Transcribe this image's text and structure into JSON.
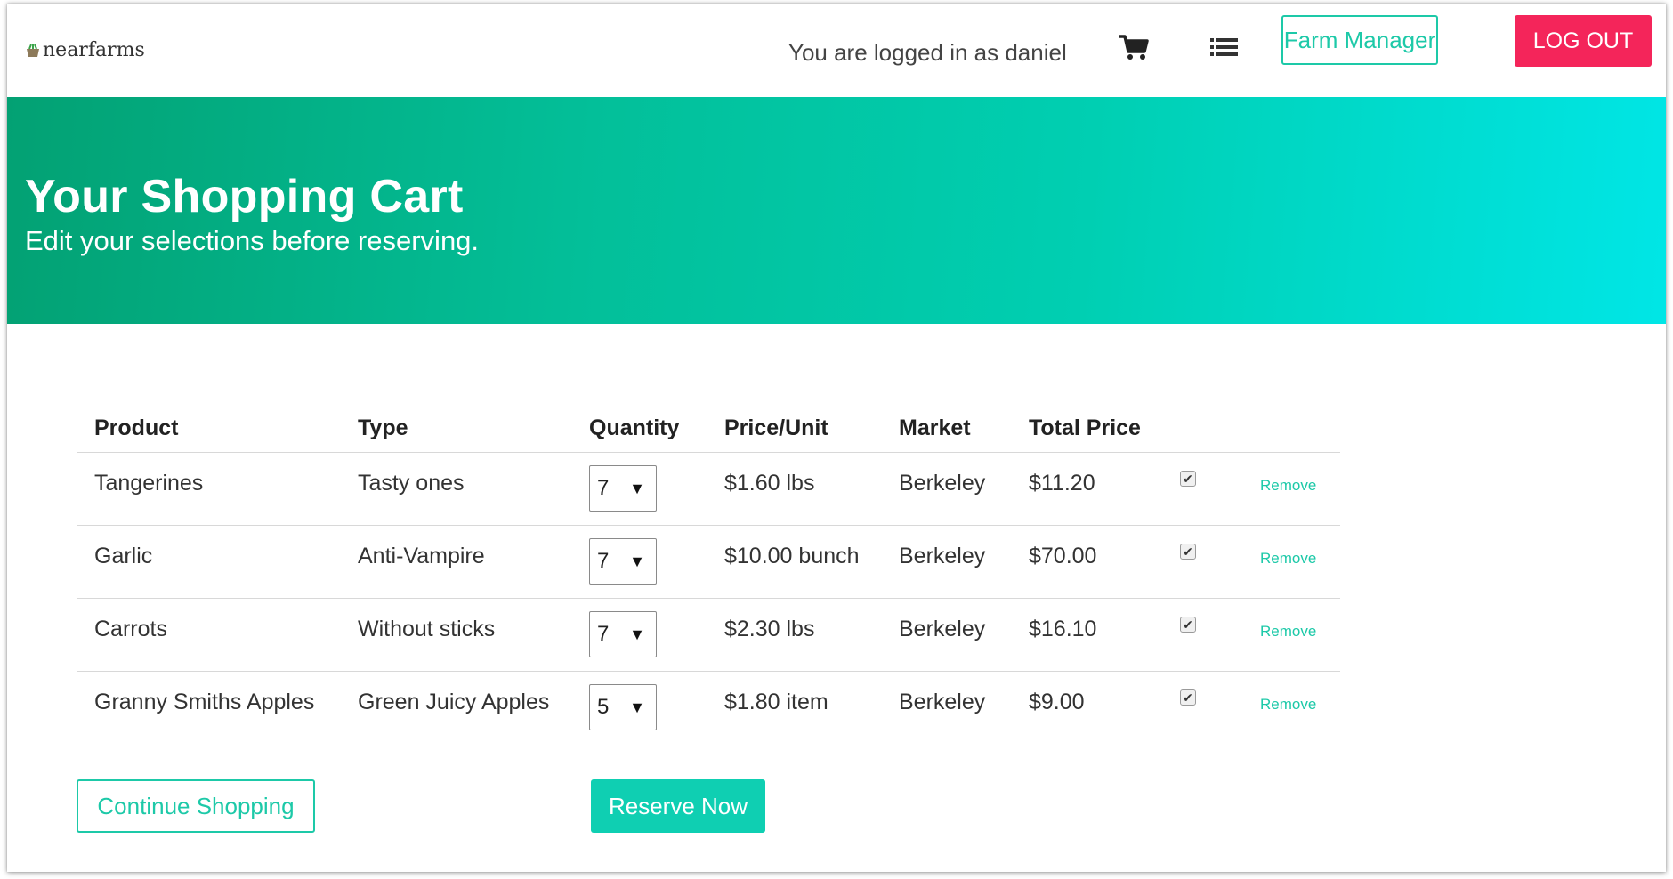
{
  "navbar": {
    "brand": "nearfarms",
    "logged_in_text": "You are logged in as daniel",
    "farm_manager_label": "Farm Manager",
    "logout_label": "LOG OUT"
  },
  "hero": {
    "title": "Your Shopping Cart",
    "subtitle": "Edit your selections before reserving."
  },
  "table": {
    "headers": [
      "Product",
      "Type",
      "Quantity",
      "Price/Unit",
      "Market",
      "Total Price"
    ],
    "rows": [
      {
        "product": "Tangerines",
        "type": "Tasty ones",
        "quantity": "7",
        "price_unit": "$1.60 lbs",
        "market": "Berkeley",
        "total": "$11.20",
        "checked": true,
        "remove": "Remove"
      },
      {
        "product": "Garlic",
        "type": "Anti-Vampire",
        "quantity": "7",
        "price_unit": "$10.00 bunch",
        "market": "Berkeley",
        "total": "$70.00",
        "checked": true,
        "remove": "Remove"
      },
      {
        "product": "Carrots",
        "type": "Without sticks",
        "quantity": "7",
        "price_unit": "$2.30 lbs",
        "market": "Berkeley",
        "total": "$16.10",
        "checked": true,
        "remove": "Remove"
      },
      {
        "product": "Granny Smiths Apples",
        "type": "Green Juicy Apples",
        "quantity": "5",
        "price_unit": "$1.80 item",
        "market": "Berkeley",
        "total": "$9.00",
        "checked": true,
        "remove": "Remove"
      }
    ]
  },
  "actions": {
    "continue_label": "Continue Shopping",
    "reserve_label": "Reserve Now"
  },
  "icons": {
    "brand_logo": "basket-icon",
    "cart": "cart-icon",
    "menu": "list-icon",
    "quantity_arrow": "▼",
    "checkbox_mark": "✔"
  },
  "colors": {
    "accent": "#1dc9a8",
    "logout": "#f4255a",
    "hero_start": "#03a173",
    "hero_end": "#00e6e6",
    "reserve": "#0fcfb2"
  }
}
